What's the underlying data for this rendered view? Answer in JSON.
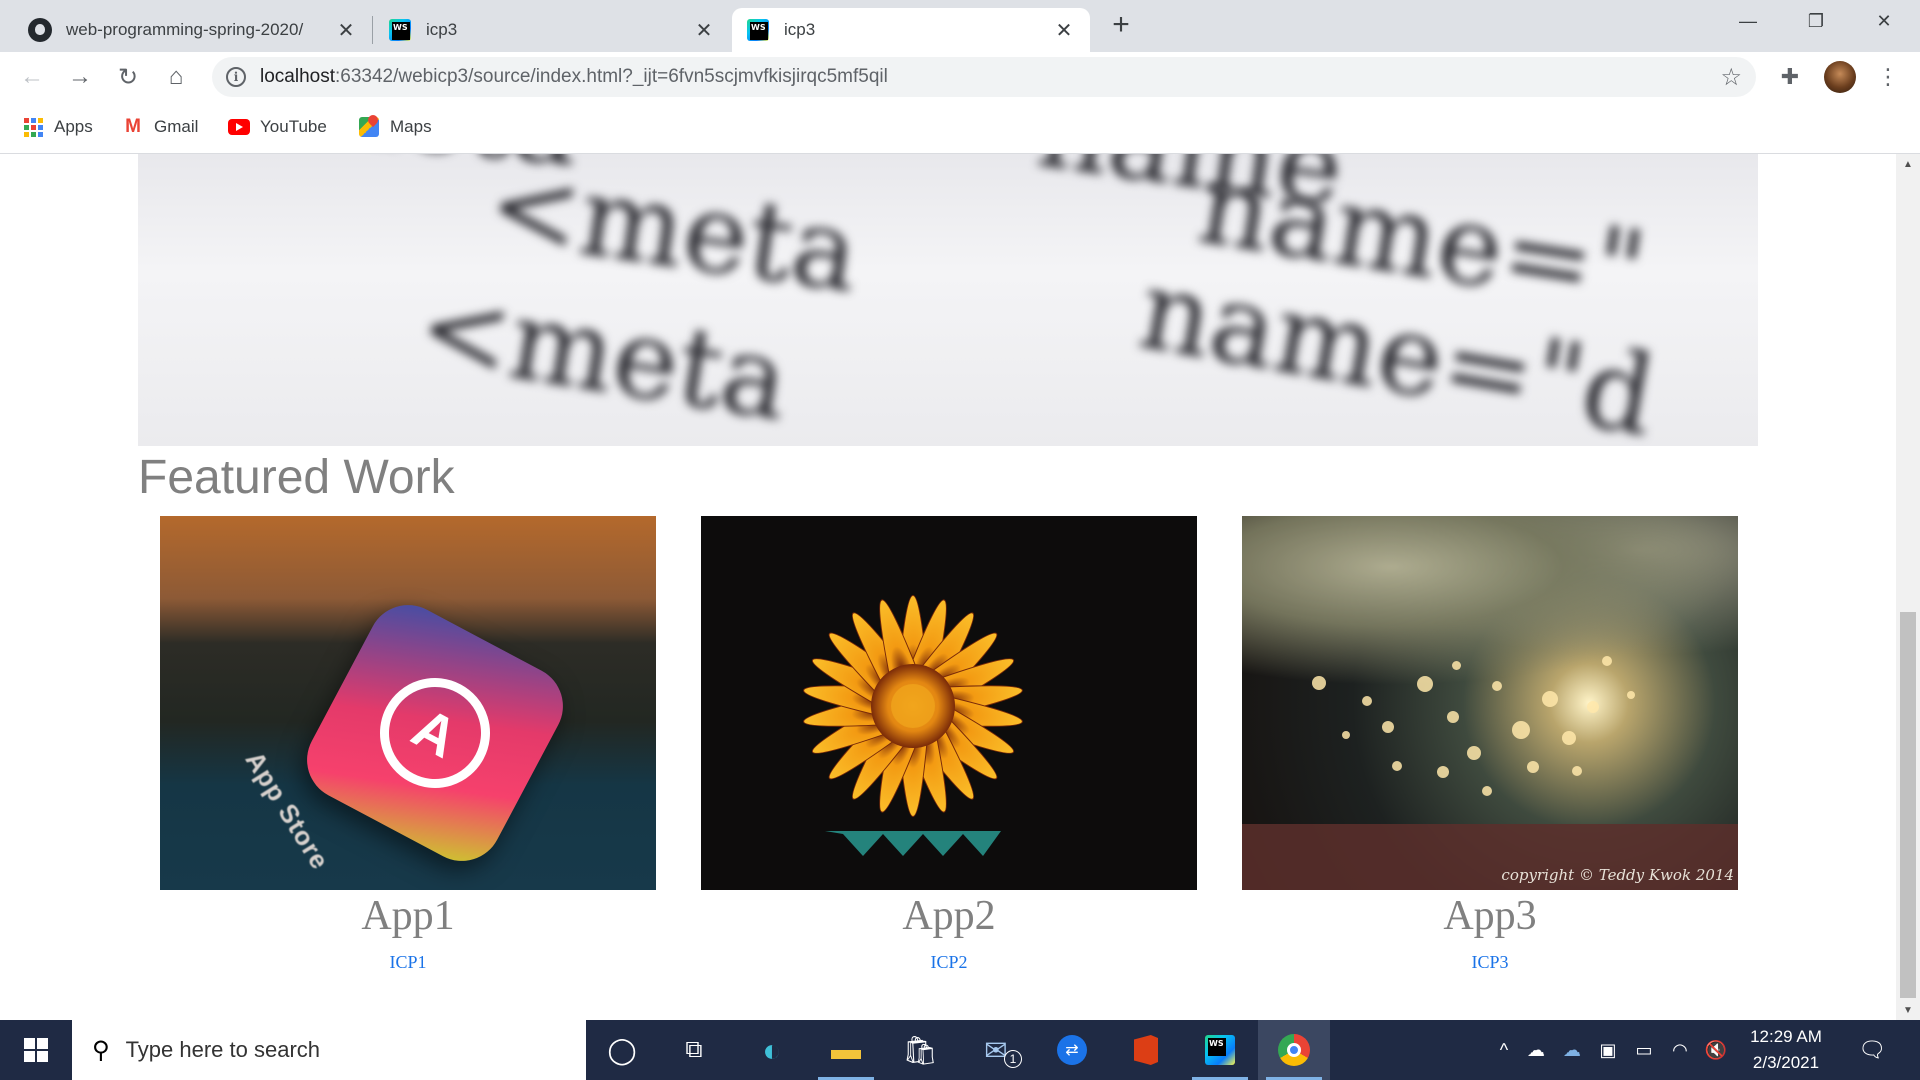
{
  "browser": {
    "tabs": [
      {
        "title": "web-programming-spring-2020/",
        "icon": "github-icon"
      },
      {
        "title": "icp3",
        "icon": "webstorm-icon"
      },
      {
        "title": "icp3",
        "icon": "webstorm-icon",
        "active": true
      }
    ],
    "new_tab_glyph": "+",
    "url_host": "localhost",
    "url_path": ":63342/webicp3/source/index.html?_ijt=6fvn5scjmvfkisjirqc5mf5qil",
    "bookmarks": [
      {
        "label": "Apps",
        "icon": "apps-grid-icon"
      },
      {
        "label": "Gmail",
        "icon": "gmail-icon"
      },
      {
        "label": "YouTube",
        "icon": "youtube-icon"
      },
      {
        "label": "Maps",
        "icon": "maps-icon"
      }
    ]
  },
  "page": {
    "hero_text": [
      "<meta",
      "name=\"",
      "<meta",
      "name=\"d",
      "<meta",
      "name"
    ],
    "section_title": "Featured Work",
    "cards": [
      {
        "name": "App1",
        "link": "ICP1",
        "image": "app-store-photo"
      },
      {
        "name": "App2",
        "link": "ICP2",
        "image": "flower-photo"
      },
      {
        "name": "App3",
        "link": "ICP3",
        "image": "bokeh-photo",
        "overlay_text": "copyright © Teddy Kwok 2014"
      }
    ],
    "appstore_label": "App Store"
  },
  "taskbar": {
    "search_placeholder": "Type here to search",
    "mail_badge": "1",
    "time": "12:29 AM",
    "date": "2/3/2021"
  },
  "colors": {
    "accent": "#1a73e8",
    "taskbar": "#1f2a44",
    "title_gray": "#808080"
  }
}
